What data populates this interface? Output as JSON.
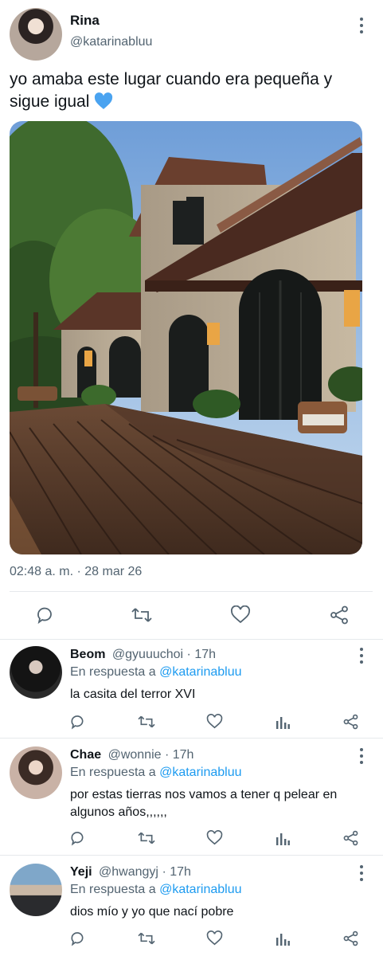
{
  "main": {
    "name": "Rina",
    "handle": "@katarinabluu",
    "text": "yo amaba este lugar cuando era pequeña y sigue igual",
    "emoji": "blue-heart",
    "timestamp": "02:48 a. m. · 28 mar 26",
    "actions": [
      "reply-icon",
      "retweet-icon",
      "like-icon",
      "share-icon"
    ]
  },
  "replies": [
    {
      "name": "Beom",
      "handle": "@gyuuuchoi",
      "time": "· 17h",
      "in_reply_prefix": "En respuesta a",
      "in_reply_mention": "@katarinabluu",
      "text": "la casita del terror XVI"
    },
    {
      "name": "Chae",
      "handle": "@wonnie",
      "time": "· 17h",
      "in_reply_prefix": "En respuesta a",
      "in_reply_mention": "@katarinabluu",
      "text": "por estas tierras nos vamos a tener q pelear en algunos años,,,,,,"
    },
    {
      "name": "Yeji",
      "handle": "@hwangyj",
      "time": "· 17h",
      "in_reply_prefix": "En respuesta a",
      "in_reply_mention": "@katarinabluu",
      "text": "dios mío y yo que nací pobre"
    }
  ],
  "colors": {
    "text": "#0f1419",
    "secondary": "#536471",
    "link": "#1d9bf0",
    "heart": "#4aa3f0"
  }
}
